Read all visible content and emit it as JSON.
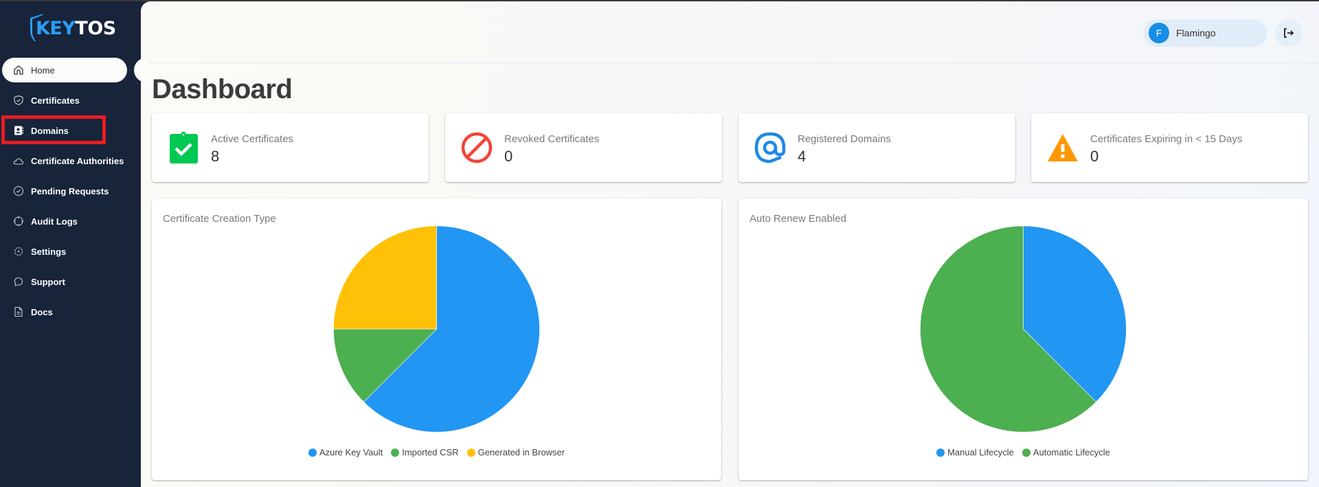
{
  "brand": {
    "logo_part1": "KEY",
    "logo_part2": "TOS",
    "primary": "#2a9df4",
    "sidebar_bg": "#17243a"
  },
  "sidebar": {
    "items": [
      {
        "label": "Home",
        "icon": "home-icon",
        "active": true
      },
      {
        "label": "Certificates",
        "icon": "shield-check-icon"
      },
      {
        "label": "Domains",
        "icon": "contact-book-icon",
        "highlighted": true
      },
      {
        "label": "Certificate Authorities",
        "icon": "cloud-icon"
      },
      {
        "label": "Pending Requests",
        "icon": "check-circle-icon"
      },
      {
        "label": "Audit Logs",
        "icon": "crosshair-icon"
      },
      {
        "label": "Settings",
        "icon": "gear-icon"
      },
      {
        "label": "Support",
        "icon": "chat-bubble-icon"
      },
      {
        "label": "Docs",
        "icon": "document-icon"
      }
    ]
  },
  "header": {
    "user": {
      "initial": "F",
      "name": "Flamingo"
    },
    "logout_icon": "logout-icon"
  },
  "page": {
    "title": "Dashboard"
  },
  "stats": [
    {
      "label": "Active Certificates",
      "value": "8",
      "icon": "clipboard-check-icon",
      "color": "#00c853"
    },
    {
      "label": "Revoked Certificates",
      "value": "0",
      "icon": "block-icon",
      "color": "#f44336"
    },
    {
      "label": "Registered Domains",
      "value": "4",
      "icon": "at-sign-icon",
      "color": "#1e88e5"
    },
    {
      "label": "Certificates Expiring in < 15 Days",
      "value": "0",
      "icon": "warning-icon",
      "color": "#ff9800"
    }
  ],
  "chart_data": [
    {
      "type": "pie",
      "title": "Certificate Creation Type",
      "categories": [
        "Azure Key Vault",
        "Imported CSR",
        "Generated in Browser"
      ],
      "values": [
        5,
        1,
        2
      ],
      "colors": [
        "#2196f3",
        "#4caf50",
        "#ffc107"
      ],
      "legend": "bottom"
    },
    {
      "type": "pie",
      "title": "Auto Renew Enabled",
      "categories": [
        "Manual Lifecycle",
        "Automatic Lifecycle"
      ],
      "values": [
        3,
        5
      ],
      "colors": [
        "#2196f3",
        "#4caf50"
      ],
      "legend": "bottom"
    }
  ]
}
